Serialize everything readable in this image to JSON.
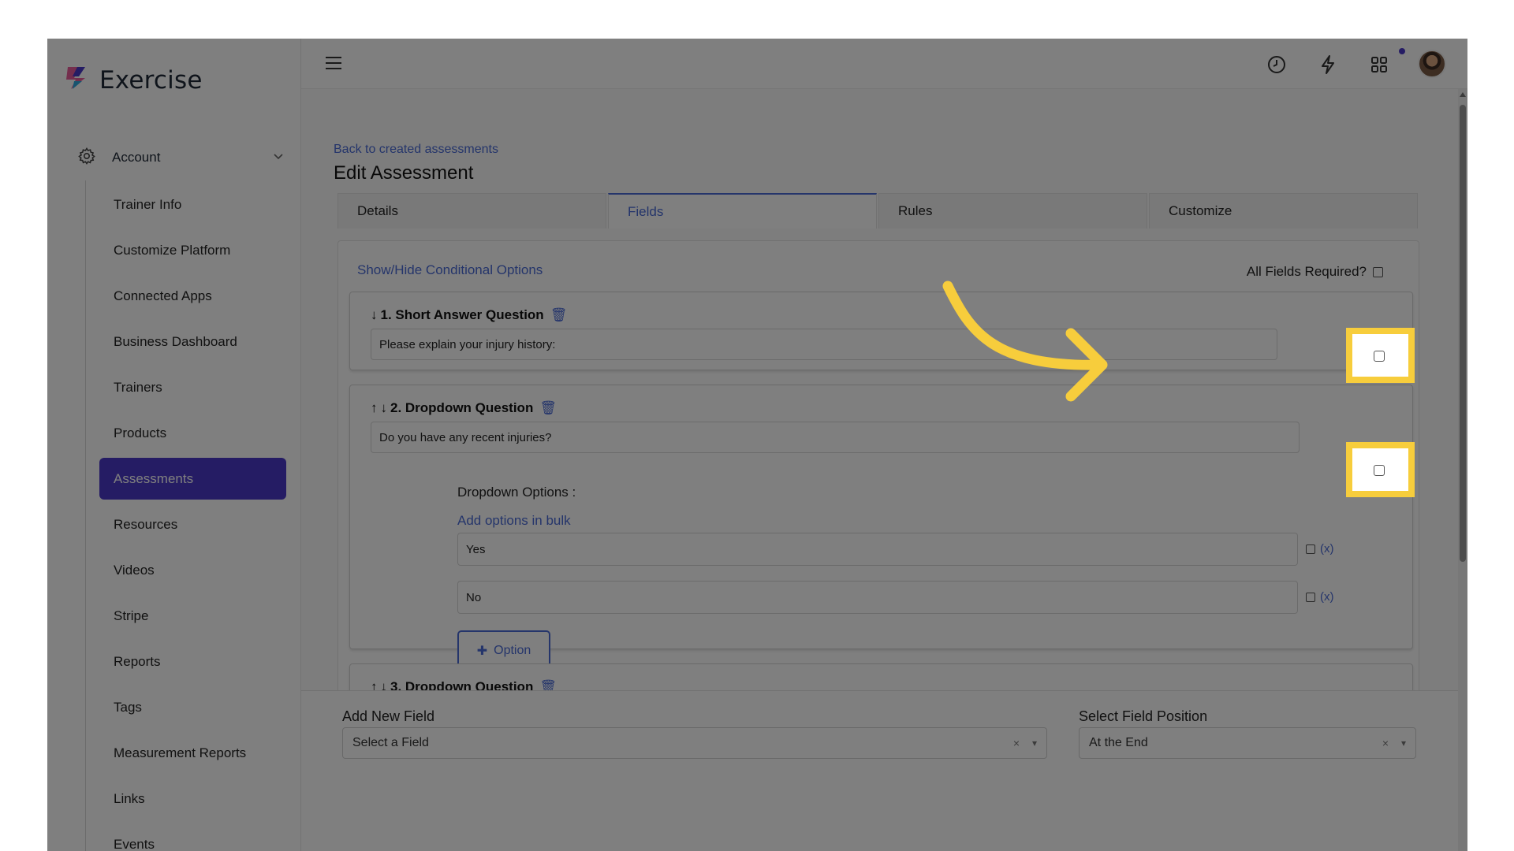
{
  "app": {
    "name": "Exercise"
  },
  "sidebar": {
    "account_label": "Account",
    "items": [
      {
        "label": "Trainer Info"
      },
      {
        "label": "Customize Platform"
      },
      {
        "label": "Connected Apps"
      },
      {
        "label": "Business Dashboard"
      },
      {
        "label": "Trainers"
      },
      {
        "label": "Products"
      },
      {
        "label": "Assessments",
        "active": true
      },
      {
        "label": "Resources"
      },
      {
        "label": "Videos"
      },
      {
        "label": "Stripe"
      },
      {
        "label": "Reports"
      },
      {
        "label": "Tags"
      },
      {
        "label": "Measurement Reports"
      },
      {
        "label": "Links"
      },
      {
        "label": "Events"
      }
    ]
  },
  "topbar": {
    "icons": [
      "clock-icon",
      "lightning-icon",
      "apps-grid-icon",
      "bell-icon",
      "avatar"
    ]
  },
  "page": {
    "back_link": "Back to created assessments",
    "title": "Edit Assessment",
    "tabs": [
      {
        "label": "Details"
      },
      {
        "label": "Fields",
        "active": true
      },
      {
        "label": "Rules"
      },
      {
        "label": "Customize"
      }
    ]
  },
  "fields": {
    "show_hide_link": "Show/Hide Conditional Options",
    "all_required_label": "All Fields Required?",
    "questions": [
      {
        "title": "1. Short Answer Question",
        "text": "Please explain your injury history:"
      },
      {
        "title": "2. Dropdown Question",
        "text": "Do you have any recent injuries?"
      },
      {
        "title": "3. Dropdown Question"
      }
    ],
    "dropdown": {
      "label": "Dropdown Options :",
      "bulk_link": "Add options in bulk",
      "options": [
        {
          "value": "Yes",
          "var_label": "(x)"
        },
        {
          "value": "No",
          "var_label": "(x)"
        }
      ],
      "add_option_label": "Option"
    }
  },
  "bottom": {
    "add_field_label": "Add New Field",
    "add_field_placeholder": "Select a Field",
    "position_label": "Select Field Position",
    "position_value": "At the End",
    "clear_glyph": "×",
    "caret_glyph": "▾"
  },
  "colors": {
    "accent": "#4b38c8",
    "link": "#4a6bd6",
    "highlight": "#f7cd3c"
  }
}
